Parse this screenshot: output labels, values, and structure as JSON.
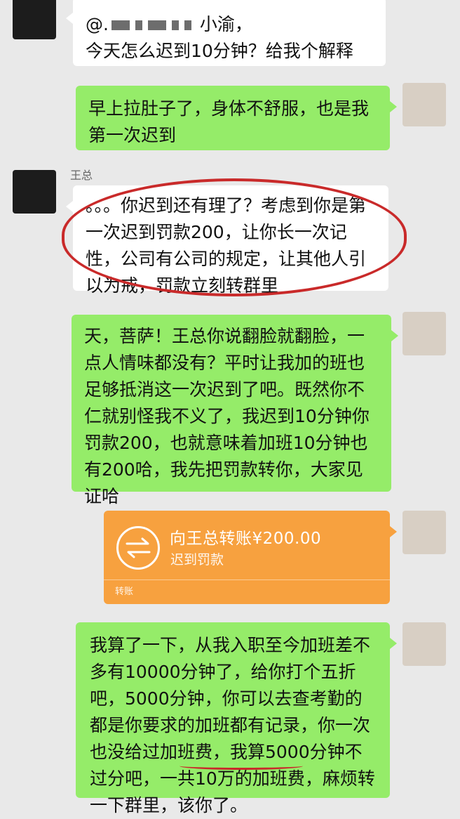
{
  "chat": {
    "sender_name": "王总",
    "messages": [
      {
        "side": "left",
        "text_prefix": "@.",
        "text_suffix": "小渝，",
        "line2": "今天怎么迟到10分钟？给我个解释"
      },
      {
        "side": "right",
        "text": "早上拉肚子了，身体不舒服，也是我第一次迟到"
      },
      {
        "side": "left",
        "text": "。。。你迟到还有理了？考虑到你是第一次迟到罚款200，让你长一次记性，公司有公司的规定，让其他人引以为戒，罚款立刻转群里"
      },
      {
        "side": "right",
        "text": "天，菩萨！王总你说翻脸就翻脸，一点人情味都没有？平时让我加的班也足够抵消这一次迟到了吧。既然你不仁就别怪我不义了，我迟到10分钟你罚款200，也就意味着加班10分钟也有200哈，我先把罚款转你，大家见证哈"
      },
      {
        "side": "right",
        "text": "我算了一下，从我入职至今加班差不多有10000分钟了，给你打个五折吧，5000分钟，你可以去查考勤的都是你要求的加班都有记录，你一次也没给过加班费，我算5000分钟不过分吧，一共10万的加班费，麻烦转一下群里，该你了。"
      }
    ],
    "transfer": {
      "title": "向王总转账¥200.00",
      "subtitle": "迟到罚款",
      "footer": "转账",
      "icon": "transfer-arrows-icon"
    }
  },
  "colors": {
    "background": "#e9e9e9",
    "bubble_green": "#95ec69",
    "bubble_white": "#ffffff",
    "transfer_orange": "#f7a13f",
    "highlight_red": "#c92a2a"
  }
}
